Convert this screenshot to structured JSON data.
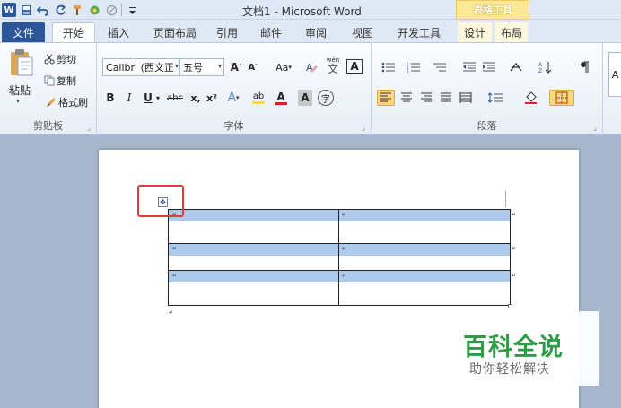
{
  "window": {
    "title": "文档1 - Microsoft Word",
    "context_tools_label": "表格工具"
  },
  "qat": {
    "app_icon": "W",
    "icons": [
      "save-icon",
      "undo-icon",
      "redo-icon",
      "format-painter-icon",
      "object-icon",
      "clear-icon",
      "customize-icon"
    ]
  },
  "tabs": [
    "文件",
    "开始",
    "插入",
    "页面布局",
    "引用",
    "邮件",
    "审阅",
    "视图",
    "开发工具",
    "设计",
    "布局"
  ],
  "clipboard": {
    "paste": "粘贴",
    "cut": "剪切",
    "copy": "复制",
    "format_painter": "格式刷",
    "group_label": "剪贴板"
  },
  "font": {
    "family_value": "Calibri (西文正",
    "size_value": "五号",
    "case_label": "Aa",
    "pinyin_label": "wén",
    "bold": "B",
    "italic": "I",
    "underline": "U",
    "strike": "abc",
    "subscript": "x,",
    "superscript": "x²",
    "effects": "A",
    "highlight": "ab",
    "font_color": "A",
    "shading": "A",
    "enclose": "字",
    "group_label": "字体",
    "grow": "A",
    "shrink": "A",
    "border_char": "A"
  },
  "paragraph": {
    "group_label": "段落"
  },
  "colors": {
    "accent": "#2b579a",
    "context_tab": "#fbe899",
    "cell_highlight": "#aecbec",
    "annotation": "#e0393e",
    "watermark": "#2e9c47"
  },
  "watermark": {
    "title": "百科全说",
    "subtitle": "助你轻松解决"
  }
}
